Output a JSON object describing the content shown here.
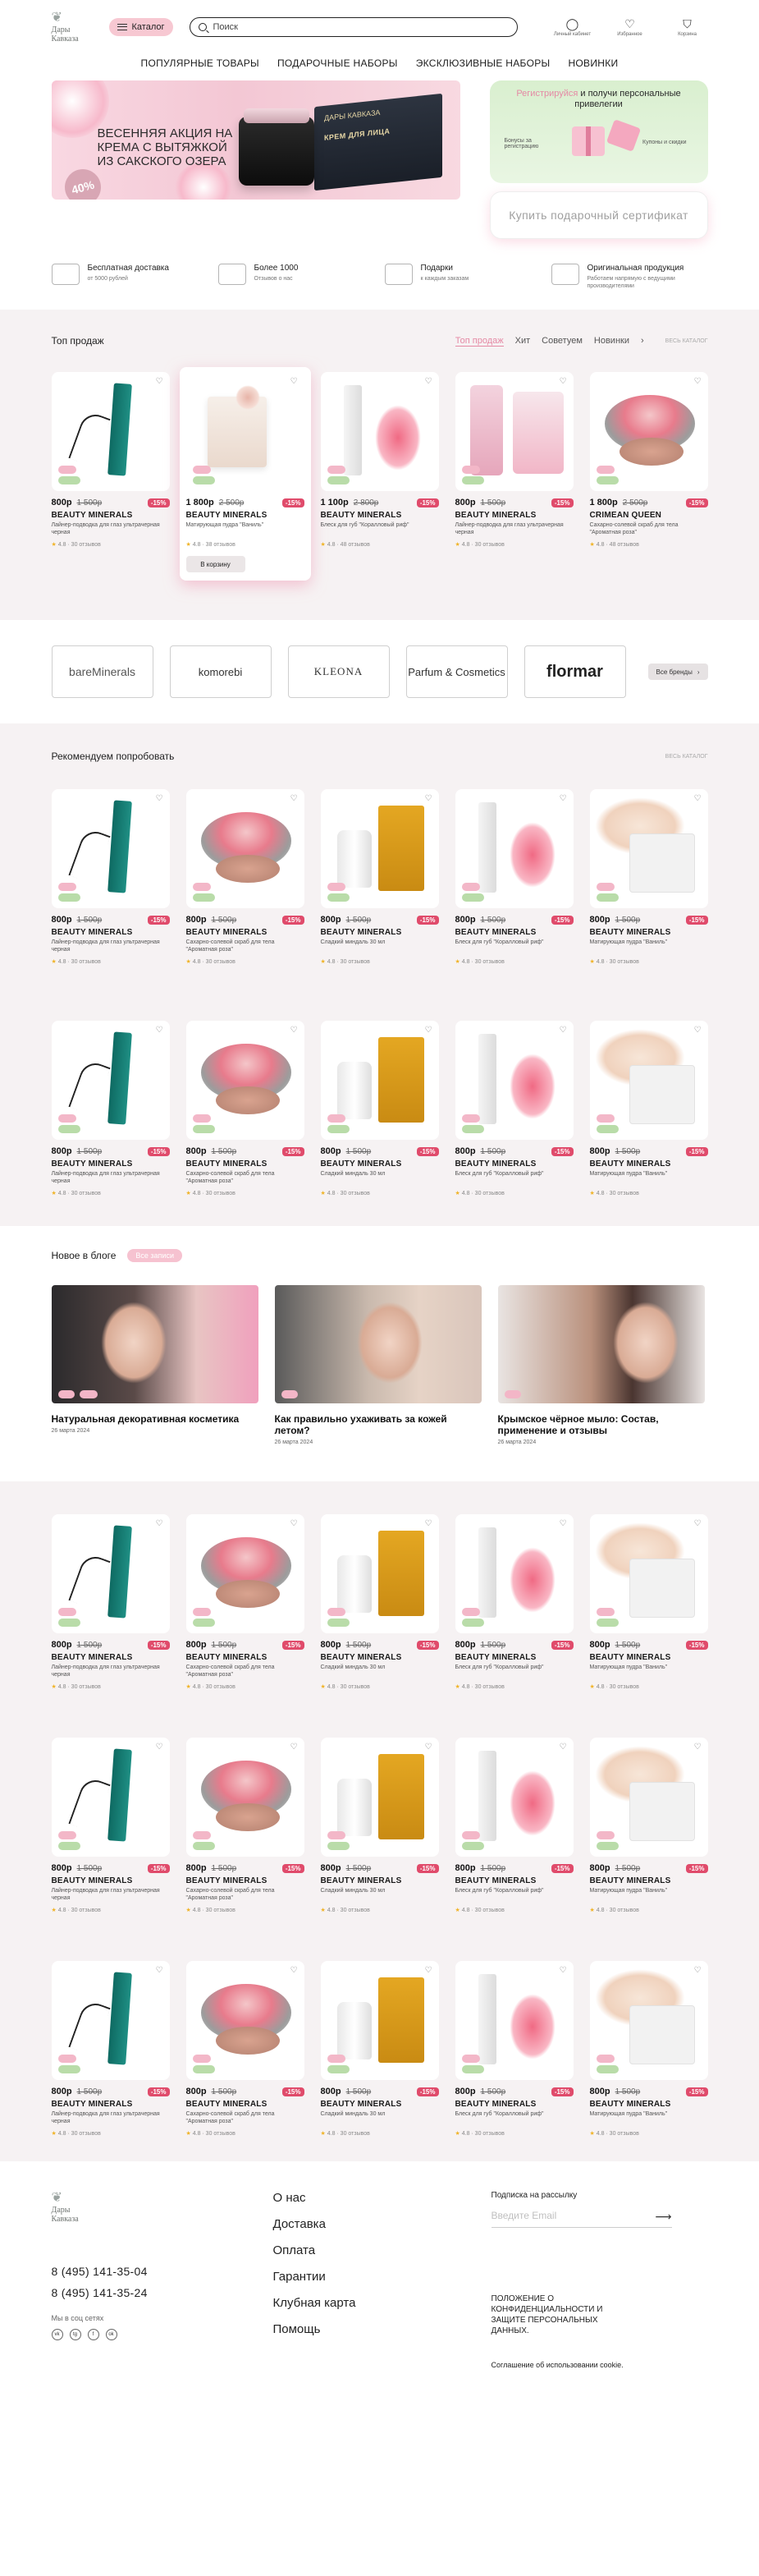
{
  "header": {
    "logo_line1": "Дары",
    "logo_line2": "Кавказа",
    "catalog_label": "Каталог",
    "search_placeholder": "Поиск",
    "icons": [
      {
        "name": "user-icon",
        "glyph": "◯",
        "label": "Личный кабинет"
      },
      {
        "name": "heart-icon",
        "glyph": "♡",
        "label": "Избранное"
      },
      {
        "name": "cart-icon",
        "glyph": "⛉",
        "label": "Корзина"
      }
    ]
  },
  "nav": [
    "ПОПУЛЯРНЫЕ ТОВАРЫ",
    "ПОДАРОЧНЫЕ НАБОРЫ",
    "ЭКСКЛЮЗИВНЫЕ НАБОРЫ",
    "НОВИНКИ"
  ],
  "hero": {
    "banner_text": "ВЕСЕННЯЯ АКЦИЯ НА КРЕМА С ВЫТЯЖКОЙ ИЗ САКСКОГО ОЗЕРА",
    "stamp": "40%",
    "box_brand": "ДАРЫ КАВКАЗА",
    "box_label": "КРЕМ ДЛЯ ЛИЦА",
    "promo_link": "Регистрируйся",
    "promo_text": " и получи персональные привелегии",
    "promo_left": "Бонусы за регистрацию",
    "promo_right": "Купоны и скидки",
    "gift_button": "Купить подарочный сертификат"
  },
  "benefits": [
    {
      "title": "Бесплатная доставка",
      "sub": "от 5000 рублей"
    },
    {
      "title": "Более 1000",
      "sub": "Отзывов о нас"
    },
    {
      "title": "Подарки",
      "sub": "к каждым заказам"
    },
    {
      "title": "Оригинальная продукция",
      "sub": "Работаем напрямую с ведущими производителями"
    }
  ],
  "top_sales": {
    "title": "Топ продаж",
    "tabs": [
      "Топ продаж",
      "Хит",
      "Советуем",
      "Новинки"
    ],
    "see_all": "ВЕСЬ КАТАЛОГ",
    "products": [
      {
        "price": "800р",
        "old": "1 500р",
        "disc": "-15%",
        "brand": "BEAUTY MINERALS",
        "name": "Лайнер-подводка для глаз ультрачерная черная",
        "rating": "4.8 · 30 отзывов"
      },
      {
        "price": "1 800р",
        "old": "2 500р",
        "disc": "-15%",
        "brand": "BEAUTY MINERALS",
        "name": "Матирующая пудра \"Ваниль\"",
        "rating": "4.8 · 38 отзывов",
        "cart": "В корзину"
      },
      {
        "price": "1 100р",
        "old": "2 800р",
        "disc": "-15%",
        "brand": "BEAUTY MINERALS",
        "name": "Блеск для губ \"Коралловый риф\"",
        "rating": "4.8 · 48 отзывов"
      },
      {
        "price": "800р",
        "old": "1 500р",
        "disc": "-15%",
        "brand": "BEAUTY MINERALS",
        "name": "Лайнер-подводка для глаз ультрачерная черная",
        "rating": "4.8 · 30 отзывов"
      },
      {
        "price": "1 800р",
        "old": "2 500р",
        "disc": "-15%",
        "brand": "CRIMEAN QUEEN",
        "name": "Сахарно-солевой скраб для тела \"Ароматная роза\"",
        "rating": "4.8 · 48 отзывов"
      }
    ]
  },
  "brands": {
    "items": [
      "bareMinerals",
      "komorebi",
      "KLEONA",
      "Parfum & Cosmetics",
      "flormar"
    ],
    "more": "Все бренды"
  },
  "recommend": {
    "title": "Рекомендуем попробовать",
    "see_all": "ВЕСЬ КАТАЛОГ"
  },
  "product_template": [
    {
      "price": "800р",
      "old": "1 500р",
      "disc": "-15%",
      "brand": "BEAUTY MINERALS",
      "name": "Лайнер-подводка для глаз ультрачерная черная",
      "rating": "4.8 · 30 отзывов"
    },
    {
      "price": "800р",
      "old": "1 500р",
      "disc": "-15%",
      "brand": "BEAUTY MINERALS",
      "name": "Сахарно-солевой скраб для тела \"Ароматная роза\"",
      "rating": "4.8 · 30 отзывов"
    },
    {
      "price": "800р",
      "old": "1 500р",
      "disc": "-15%",
      "brand": "BEAUTY MINERALS",
      "name": "Сладкий миндаль 30 мл",
      "rating": "4.8 · 30 отзывов"
    },
    {
      "price": "800р",
      "old": "1 500р",
      "disc": "-15%",
      "brand": "BEAUTY MINERALS",
      "name": "Блеск для губ \"Коралловый риф\"",
      "rating": "4.8 · 30 отзывов"
    },
    {
      "price": "800р",
      "old": "1 500р",
      "disc": "-15%",
      "brand": "BEAUTY MINERALS",
      "name": "Матирующая пудра \"Ваниль\"",
      "rating": "4.8 · 30 отзывов"
    }
  ],
  "blog": {
    "title": "Новое в блоге",
    "all": "Все записи",
    "posts": [
      {
        "title": "Натуральная декоративная косметика",
        "date": "26 марта 2024"
      },
      {
        "title": "Как правильно ухаживать за кожей летом?",
        "date": "26 марта 2024"
      },
      {
        "title": "Крымское чёрное мыло: Состав, применение и отзывы",
        "date": "26 марта 2024"
      }
    ]
  },
  "footer": {
    "logo_line1": "Дары",
    "logo_line2": "Кавказа",
    "phone1": "8 (495) 141-35-04",
    "phone2": "8 (495) 141-35-24",
    "social_label": "Мы в соц сетях",
    "socials": [
      "vk",
      "tg",
      "f",
      "ok"
    ],
    "links": [
      "О нас",
      "Доставка",
      "Оплата",
      "Гарантии",
      "Клубная карта",
      "Помощь"
    ],
    "sub_label": "Подписка на рассылку",
    "sub_placeholder": "Введите  Email",
    "policy": "ПОЛОЖЕНИЕ О КОНФИДЕНЦИАЛЬНОСТИ И ЗАЩИТЕ ПЕРСОНАЛЬНЫХ ДАННЫХ.",
    "agree": "Соглашение об использовании cookie."
  },
  "colors": {
    "accent": "#e58aa5",
    "discount": "#e04b6b",
    "section_bg": "#f6f2f3",
    "promo_bg": "#d9efcf"
  }
}
